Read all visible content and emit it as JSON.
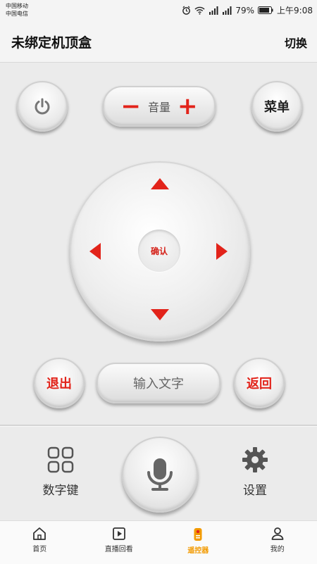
{
  "status_bar": {
    "carrier_1": "中国移动",
    "carrier_2": "中国电信",
    "battery": "79%",
    "time": "上午9:08"
  },
  "header": {
    "title": "未绑定机顶盒",
    "switch_label": "切换"
  },
  "remote": {
    "power_icon": "power-icon",
    "volume_minus": "−",
    "volume_label": "音量",
    "volume_plus": "+",
    "menu_label": "菜单",
    "ok_label": "确认",
    "exit_label": "退出",
    "text_input_label": "输入文字",
    "back_label": "返回",
    "numpad_label": "数字键",
    "mic_icon": "microphone-icon",
    "settings_label": "设置"
  },
  "tabs": [
    {
      "label": "首页",
      "icon": "home-icon",
      "active": false
    },
    {
      "label": "直播回看",
      "icon": "play-icon",
      "active": false
    },
    {
      "label": "遥控器",
      "icon": "remote-icon",
      "active": true
    },
    {
      "label": "我的",
      "icon": "user-icon",
      "active": false
    }
  ],
  "colors": {
    "accent_red": "#e2231a",
    "active_tab": "#f29a00",
    "background": "#ebebeb"
  }
}
